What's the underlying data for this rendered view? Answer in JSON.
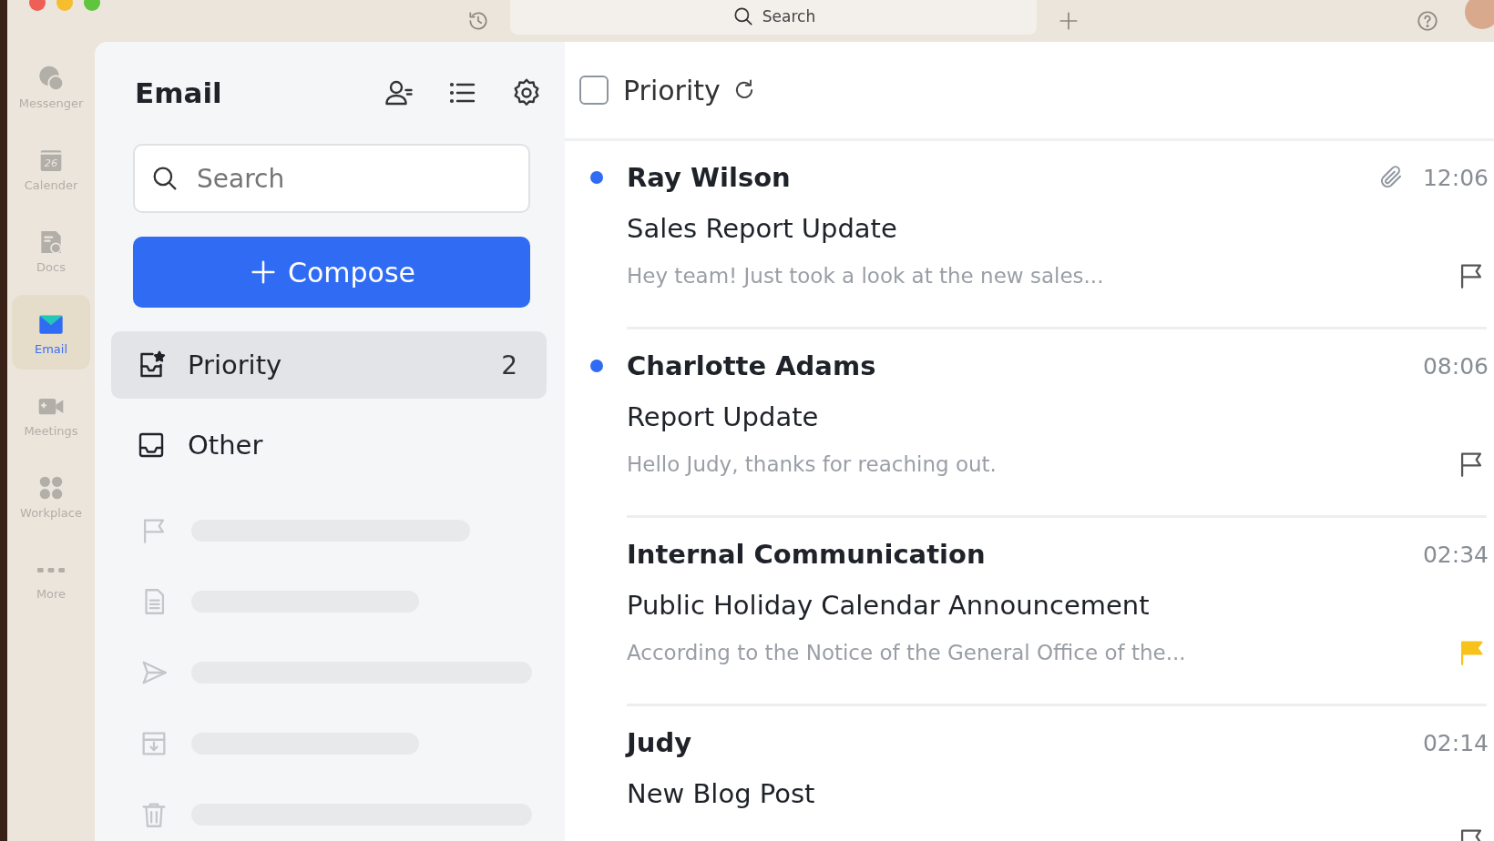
{
  "window": {
    "toolbar_search": {
      "placeholder": "Search"
    }
  },
  "rail": [
    {
      "kind": "messenger",
      "label": "Messenger",
      "selected": false
    },
    {
      "kind": "calendar",
      "label": "Calender",
      "badge": "26",
      "selected": false
    },
    {
      "kind": "docs",
      "label": "Docs",
      "selected": false
    },
    {
      "kind": "email",
      "label": "Email",
      "selected": true
    },
    {
      "kind": "meetings",
      "label": "Meetings",
      "selected": false
    },
    {
      "kind": "workplace",
      "label": "Workplace",
      "selected": false
    },
    {
      "kind": "more",
      "label": "More",
      "selected": false
    }
  ],
  "sidebar": {
    "title": "Email",
    "search": {
      "placeholder": "Search"
    },
    "compose": "Compose",
    "folders": [
      {
        "kind": "priority",
        "label": "Priority",
        "count": "2",
        "selected": true
      },
      {
        "kind": "inbox",
        "label": "Other",
        "selected": false
      }
    ],
    "loading_folders": [
      {
        "kind": "flag"
      },
      {
        "kind": "doc"
      },
      {
        "kind": "send"
      },
      {
        "kind": "archive"
      },
      {
        "kind": "trash"
      }
    ]
  },
  "list": {
    "header": {
      "checked": false,
      "label": "Priority"
    },
    "emails": [
      {
        "sender": "Ray Wilson",
        "unread": true,
        "attachment": true,
        "time": "12:06",
        "subject": "Sales Report Update",
        "preview": "Hey team! Just took a look at the new sales...",
        "flagged": false
      },
      {
        "sender": "Charlotte Adams",
        "unread": true,
        "attachment": false,
        "time": "08:06",
        "subject": "Report Update",
        "preview": "Hello Judy, thanks for reaching out.",
        "flagged": false
      },
      {
        "sender": "Internal Communication",
        "unread": false,
        "attachment": false,
        "time": "02:34",
        "subject": "Public Holiday Calendar Announcement",
        "preview": "According to the Notice of the General Office of the...",
        "flagged": true
      },
      {
        "sender": "Judy",
        "unread": false,
        "attachment": false,
        "time": "02:14",
        "subject": "New Blog Post",
        "flagged": false
      }
    ]
  }
}
